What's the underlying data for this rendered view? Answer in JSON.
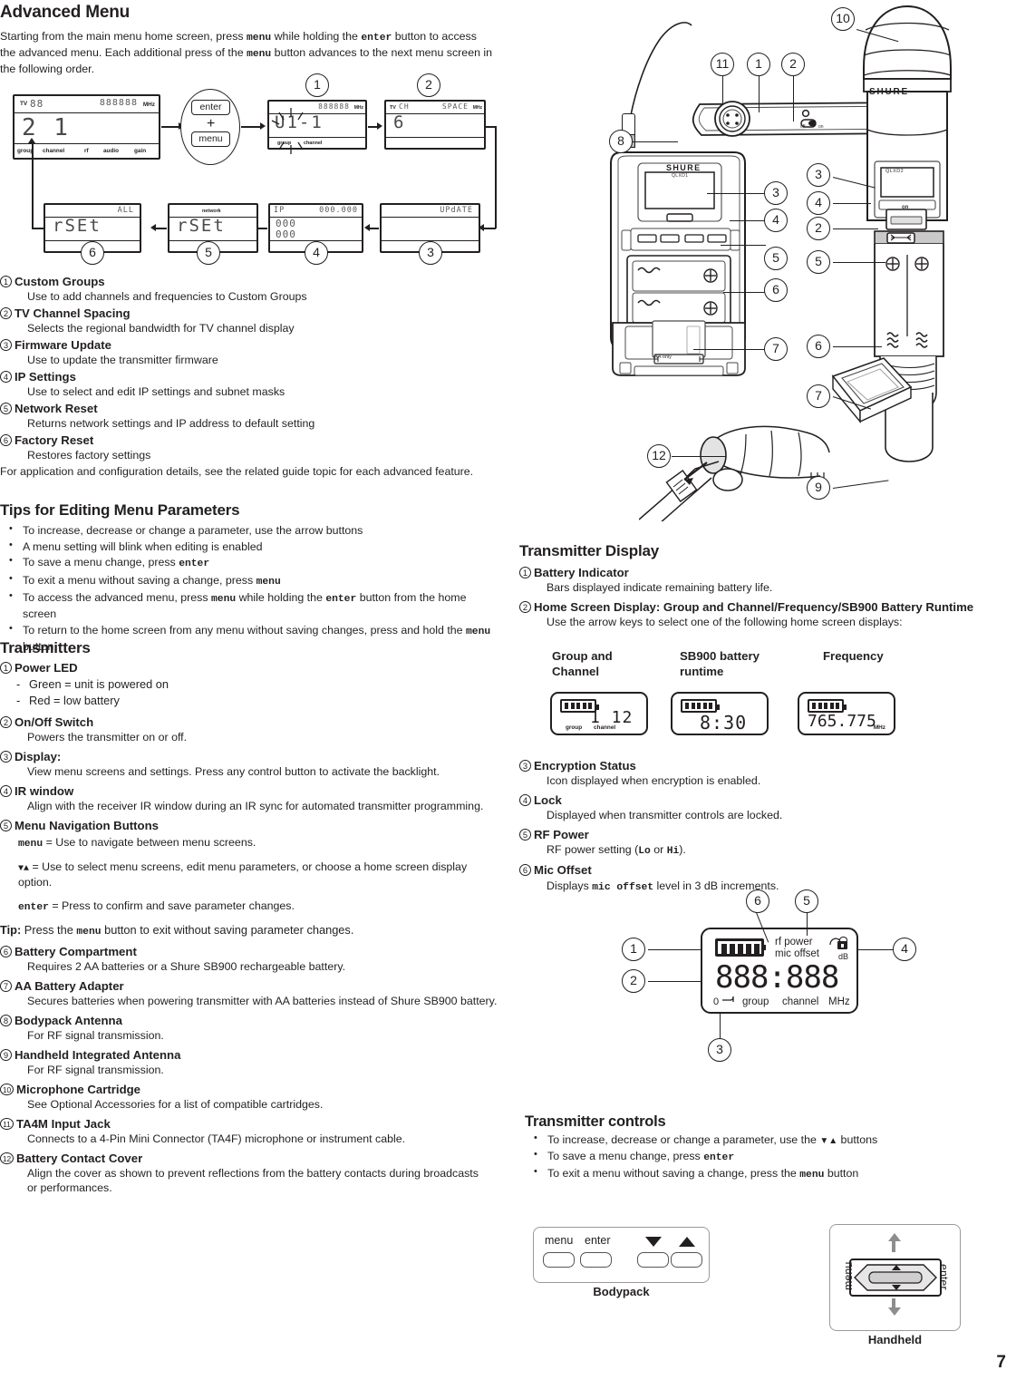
{
  "page_number": "7",
  "left_column": {
    "advanced_menu": {
      "heading": "Advanced Menu",
      "intro": "Starting from the main menu home screen, press menu while holding the enter button to access the advanced menu. Each additional press of the menu button advances to the next menu screen in the following order.",
      "intro_parts": {
        "p1": "Starting from the main menu home screen, press ",
        "mono1": "menu",
        "p2": " while holding the ",
        "mono2": "enter",
        "p3": " button to access the advanced menu. Each additional press of the ",
        "mono3": "menu",
        "p4": " button advances to the next menu screen in the following order."
      },
      "flow": {
        "screen_home": {
          "tv_label": "TV",
          "tv_value": "88",
          "freq_value": "888888",
          "mhz": "MHz",
          "main": "2  1",
          "bottom_labels": [
            "group",
            "channel",
            "rf",
            "audio",
            "gain"
          ]
        },
        "keys": {
          "enter": "enter",
          "plus": "+",
          "menu": "menu"
        },
        "screen_1": {
          "freq_value": "888888",
          "mhz": "MHz",
          "main": "U1-1",
          "bottom_labels": [
            "group",
            "channel"
          ]
        },
        "screen_2": {
          "tv_label": "TV",
          "tv_value": "CH",
          "right_value": "SPACE",
          "mhz": "MHz",
          "main": "6"
        },
        "screen_3": {
          "right_value": "UPdATE"
        },
        "screen_4": {
          "left_label": "IP",
          "right_value": "000.000",
          "line2": "000",
          "line3": "000"
        },
        "screen_5": {
          "top_label": "network",
          "main": "rSEt"
        },
        "screen_6": {
          "right_value": "ALL",
          "main": "rSEt"
        },
        "callouts": [
          "1",
          "2",
          "3",
          "4",
          "5",
          "6"
        ]
      },
      "items": [
        {
          "num": "1",
          "title": "Custom Groups",
          "desc": "Use to add channels and frequencies to Custom Groups"
        },
        {
          "num": "2",
          "title": "TV Channel Spacing",
          "desc": "Selects the regional bandwidth for TV channel display"
        },
        {
          "num": "3",
          "title": "Firmware Update",
          "desc": "Use to update the transmitter firmware"
        },
        {
          "num": "4",
          "title": "IP Settings",
          "desc": "Use to select and edit IP settings and subnet masks"
        },
        {
          "num": "5",
          "title": "Network Reset",
          "desc": "Returns network settings and IP address to default setting"
        },
        {
          "num": "6",
          "title": "Factory Reset",
          "desc": "Restores factory settings"
        }
      ],
      "footnote": "For application and configuration details, see the related guide topic for each advanced feature."
    },
    "tips": {
      "heading": "Tips for Editing Menu Parameters",
      "bullets": [
        {
          "pre": "To increase, decrease or change a parameter, use the arrow buttons",
          "mono": "",
          "post": ""
        },
        {
          "pre": "A menu setting will blink when editing is enabled",
          "mono": "",
          "post": ""
        },
        {
          "pre": "To save a menu change, press ",
          "mono": "enter",
          "post": ""
        },
        {
          "pre": "To exit a menu without saving a change, press ",
          "mono": "menu",
          "post": ""
        },
        {
          "pre": "To access the advanced menu, press ",
          "mono": "menu",
          "post": " while holding the ",
          "mono2": "enter",
          "post2": " button from the home screen"
        },
        {
          "pre": "To return to the home screen from any menu without saving changes, press and hold the ",
          "mono": "menu",
          "post": " button."
        }
      ]
    },
    "transmitters": {
      "heading": "Transmitters",
      "items": [
        {
          "num": "1",
          "title": "Power LED",
          "dashes": [
            "Green = unit is powered on",
            "Red = low battery"
          ]
        },
        {
          "num": "2",
          "title": "On/Off Switch",
          "desc": "Powers the transmitter on or off."
        },
        {
          "num": "3",
          "title": "Display:",
          "desc": "View menu screens and settings. Press any control button to activate the backlight."
        },
        {
          "num": "4",
          "title": "IR window",
          "desc": "Align with the receiver IR window during an IR sync for automated transmitter programming."
        },
        {
          "num": "5",
          "title": "Menu Navigation Buttons",
          "lines": [
            {
              "mono": "menu",
              "text": " = Use to navigate between menu screens."
            },
            {
              "mono": "▼▲",
              "text": " = Use to select menu screens, edit menu parameters, or choose a home screen display option."
            },
            {
              "mono": "enter",
              "text": " = Press to confirm and save parameter changes."
            }
          ],
          "tip": {
            "label": "Tip:",
            "pre": " Press the ",
            "mono": "menu",
            "post": " button to exit without saving parameter changes."
          }
        },
        {
          "num": "6",
          "title": "Battery Compartment",
          "desc": "Requires 2 AA batteries or a Shure SB900 rechargeable battery."
        },
        {
          "num": "7",
          "title": "AA Battery Adapter",
          "desc": "Secures batteries when powering transmitter with AA batteries instead of Shure SB900 battery."
        },
        {
          "num": "8",
          "title": "Bodypack Antenna",
          "desc": "For RF signal transmission."
        },
        {
          "num": "9",
          "title": "Handheld Integrated Antenna",
          "desc": "For RF signal transmission."
        },
        {
          "num": "10",
          "title": "Microphone Cartridge",
          "desc": "See Optional Accessories for a list of compatible cartridges."
        },
        {
          "num": "11",
          "title": "TA4M Input Jack",
          "desc": "Connects to a 4-Pin Mini Connector (TA4F) microphone or instrument cable."
        },
        {
          "num": "12",
          "title": "Battery Contact Cover",
          "desc": "Align the cover as shown to prevent reflections from the battery contacts during broadcasts or performances."
        }
      ]
    }
  },
  "right_column": {
    "illustration": {
      "bodypack_brand": "SHURE",
      "bodypack_model": "QLXD1",
      "handheld_brand": "SHURE",
      "handheld_model": "QLXD2",
      "switch_off": "off",
      "switch_on": "on",
      "handheld_on": "on",
      "aa_only": "AA only",
      "callouts": [
        "1",
        "2",
        "3",
        "4",
        "5",
        "6",
        "7",
        "8",
        "9",
        "10",
        "11",
        "12"
      ]
    },
    "transmitter_display": {
      "heading": "Transmitter Display",
      "items": [
        {
          "num": "1",
          "title": "Battery Indicator",
          "desc": "Bars displayed indicate remaining battery life."
        },
        {
          "num": "2",
          "title": "Home Screen Display: Group and Channel/Frequency/SB900 Battery Runtime",
          "desc": "Use the arrow keys to select one of the following home screen displays:"
        },
        {
          "num": "3",
          "title": "Encryption Status",
          "desc": "Icon displayed when encryption is enabled."
        },
        {
          "num": "4",
          "title": "Lock",
          "desc": "Displayed when transmitter controls are locked."
        },
        {
          "num": "5",
          "title": "RF Power",
          "desc_pre": "RF power setting (",
          "mono1": "Lo",
          "desc_mid": " or ",
          "mono2": "Hi",
          "desc_post": ")."
        },
        {
          "num": "6",
          "title": "Mic Offset",
          "desc_pre": "Displays ",
          "mono1": "mic offset",
          "desc_post": " level in 3 dB increments."
        }
      ],
      "home_screens": [
        {
          "label": "Group and Channel",
          "value": "1 12",
          "sub_left": "group",
          "sub_right": "channel",
          "unit": ""
        },
        {
          "label": "SB900 battery runtime",
          "value": "8:30",
          "sub_left": "",
          "sub_right": "",
          "unit": ""
        },
        {
          "label": "Frequency",
          "value": "765.775",
          "sub_left": "",
          "sub_right": "",
          "unit": "MHz"
        }
      ],
      "display_diagram": {
        "rf_power": "rf power",
        "mic_offset": "mic offset",
        "db": "dB",
        "zero": "0",
        "digits": "888:888",
        "group": "group",
        "channel": "channel",
        "mhz": "MHz",
        "callouts": [
          "1",
          "2",
          "3",
          "4",
          "5",
          "6"
        ]
      }
    },
    "transmitter_controls": {
      "heading": "Transmitter controls",
      "bullets": [
        {
          "pre": "To increase, decrease or change a parameter, use the ",
          "mono": "▼▲",
          "post": " buttons"
        },
        {
          "pre": "To save a menu change, press ",
          "mono": "enter",
          "post": ""
        },
        {
          "pre": "To exit a menu without saving a change, press the ",
          "mono": "menu",
          "post": " button"
        }
      ],
      "bodypack_panel": {
        "caption": "Bodypack",
        "keys": [
          "menu",
          "enter"
        ],
        "arrows": [
          "▼",
          "▲"
        ]
      },
      "handheld_panel": {
        "caption": "Handheld",
        "left_label": "menu",
        "right_label": "enter"
      }
    }
  }
}
